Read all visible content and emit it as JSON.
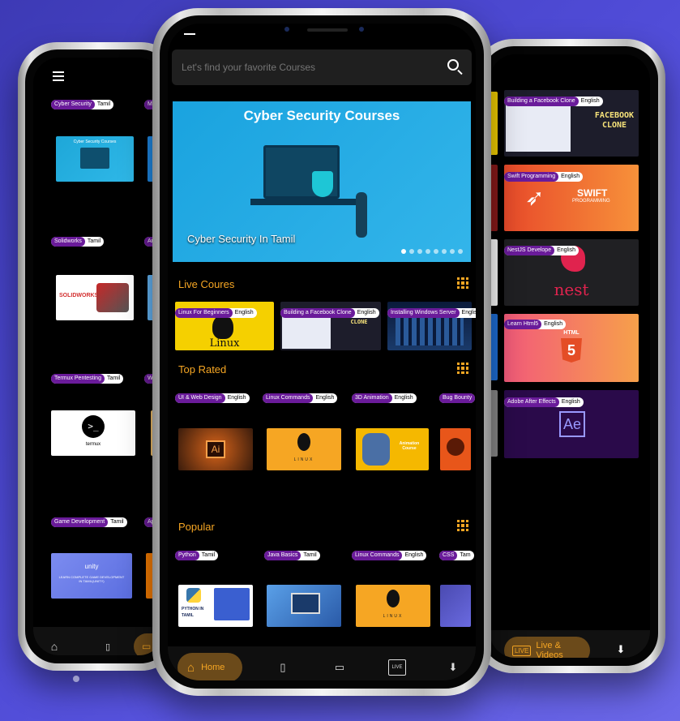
{
  "left_phone": {
    "cards": [
      {
        "title": "Cyber Security",
        "lang": "Tamil",
        "thumb_text": "Cyber Security Courses"
      },
      {
        "title": "Meta",
        "lang": ""
      },
      {
        "title": "Solidworks",
        "lang": "Tamil",
        "thumb_text": "SOLIDWORKS"
      },
      {
        "title": "Andr",
        "lang": ""
      },
      {
        "title": "Termux Pentesting",
        "lang": "Tamil",
        "thumb_text": "termux"
      },
      {
        "title": "WAPT",
        "lang": ""
      },
      {
        "title": "Game Development",
        "lang": "Tamil",
        "thumb_text": "unity",
        "thumb_sub": "LEARN COMPLETE GAME DEVELOPMENT IN TAMIL(UNITY)"
      },
      {
        "title": "App D",
        "lang": ""
      }
    ]
  },
  "center_phone": {
    "search": {
      "placeholder": "Let's find your favorite Courses"
    },
    "banner": {
      "heading": "Cyber Security Courses",
      "caption": "Cyber Security In Tamil"
    },
    "sections": {
      "live": {
        "title": "Live Coures"
      },
      "top": {
        "title": "Top Rated"
      },
      "popular": {
        "title": "Popular"
      }
    },
    "live_cards": [
      {
        "title": "Linux For Beginners",
        "lang": "English",
        "thumb": "Linux"
      },
      {
        "title": "Building a Facebook Clone",
        "lang": "English",
        "thumb": "FACEBOOK CLONE"
      },
      {
        "title": "Installing Windows Server",
        "lang": "English"
      }
    ],
    "top_cards": [
      {
        "title": "UI & Web Design",
        "lang": "English",
        "thumb": "Ai"
      },
      {
        "title": "Linux Commands",
        "lang": "English",
        "thumb": "LINUX"
      },
      {
        "title": "3D Animation",
        "lang": "English",
        "thumb": "Animation Course"
      },
      {
        "title": "Bug Bounty",
        "lang": ""
      }
    ],
    "popular_cards": [
      {
        "title": "Python",
        "lang": "Tamil",
        "thumb": "PYTHON IN TAMIL"
      },
      {
        "title": "Java Basics",
        "lang": "Tamil"
      },
      {
        "title": "Linux Commands",
        "lang": "English",
        "thumb": "LINUX"
      },
      {
        "title": "CSS",
        "lang": "Tam"
      }
    ],
    "nav": {
      "home_label": "Home"
    }
  },
  "right_phone": {
    "cards": [
      {
        "title": "Building a Facebook Clone",
        "lang": "English",
        "thumb": "FACEBOOK CLONE"
      },
      {
        "title": "Swift Programming",
        "lang": "English",
        "thumb": "SWIFT",
        "thumb_sub": "PROGRAMMING"
      },
      {
        "title": "NestJS Develope",
        "lang": "English",
        "thumb": "nest"
      },
      {
        "title": "Learn Html5",
        "lang": "English",
        "thumb": "HTML"
      },
      {
        "title": "Adobe After Effects",
        "lang": "English",
        "thumb": "Ae"
      }
    ],
    "nav": {
      "live_label": "Live & Videos"
    }
  },
  "colors": {
    "accent": "#f6a623",
    "tag_purple": "#6a1b9a",
    "background": "#4f4bd6"
  }
}
